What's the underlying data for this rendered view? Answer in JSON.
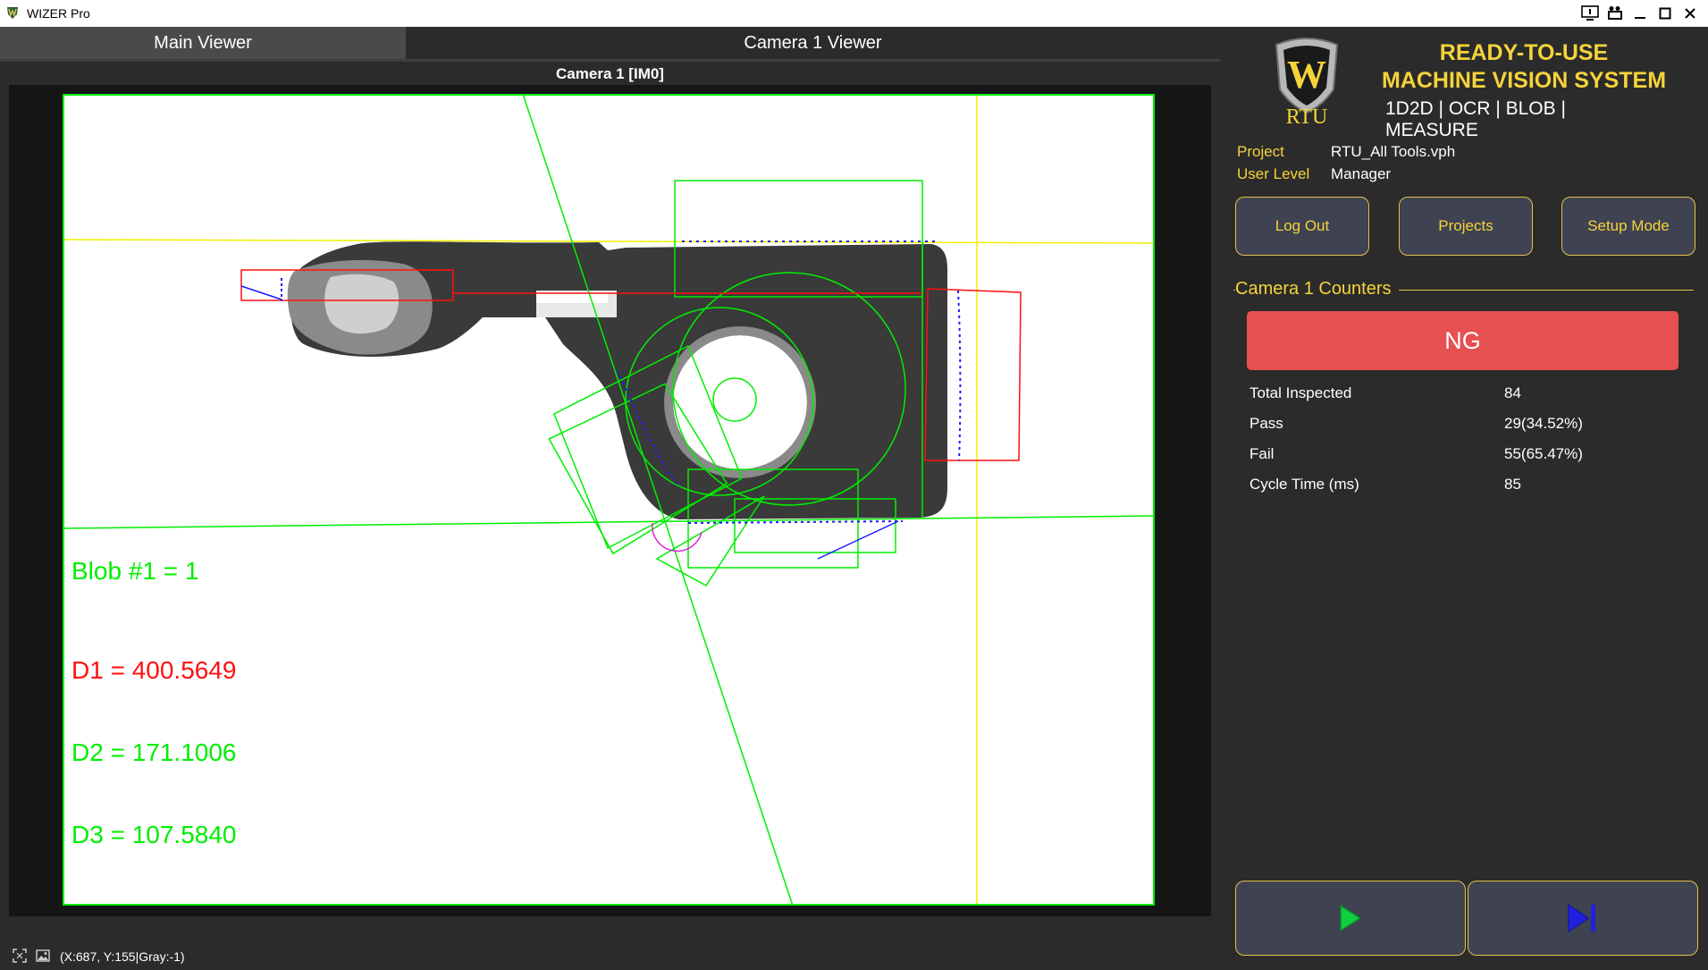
{
  "window": {
    "title": "WIZER Pro",
    "icons": [
      "app-icon",
      "monitor-info-icon",
      "camera-settings-icon",
      "minimize-icon",
      "maximize-icon",
      "close-icon"
    ]
  },
  "tabs": [
    {
      "label": "Main Viewer"
    },
    {
      "label": "Camera 1 Viewer"
    }
  ],
  "viewer": {
    "caption": "Camera 1  [IM0]",
    "overlays": {
      "blob": "Blob #1 = 1",
      "d1": "D1 = 400.5649",
      "d2": "D2 = 171.1006",
      "d3": "D3 = 107.5840"
    },
    "colors": {
      "pass": "#00ee00",
      "fail": "#ff1010",
      "guide": "#f0f000",
      "edge_points": "#1a1aff"
    }
  },
  "status_bar": {
    "coords": "(X:687, Y:155|Gray:-1)"
  },
  "brand": {
    "logo_text": "RTU",
    "logo_letter": "W",
    "headline_1": "READY-TO-USE",
    "headline_2": "MACHINE VISION SYSTEM",
    "tools": "1D2D | OCR | BLOB | MEASURE",
    "accent": "#f5d33a"
  },
  "project": {
    "project_label": "Project",
    "project_value": "RTU_All Tools.vph",
    "user_label": "User Level",
    "user_value": "Manager"
  },
  "buttons": {
    "logout": "Log Out",
    "projects": "Projects",
    "setup": "Setup Mode"
  },
  "counters": {
    "title": "Camera 1 Counters",
    "result": "NG",
    "result_color": "#e65050",
    "rows": [
      {
        "label": "Total Inspected",
        "value": "84"
      },
      {
        "label": "Pass",
        "value": "29(34.52%)"
      },
      {
        "label": "Fail",
        "value": "55(65.47%)"
      },
      {
        "label": "Cycle Time (ms)",
        "value": "85"
      }
    ]
  },
  "controls": {
    "run_icon": "play-icon",
    "step_icon": "step-forward-icon"
  }
}
